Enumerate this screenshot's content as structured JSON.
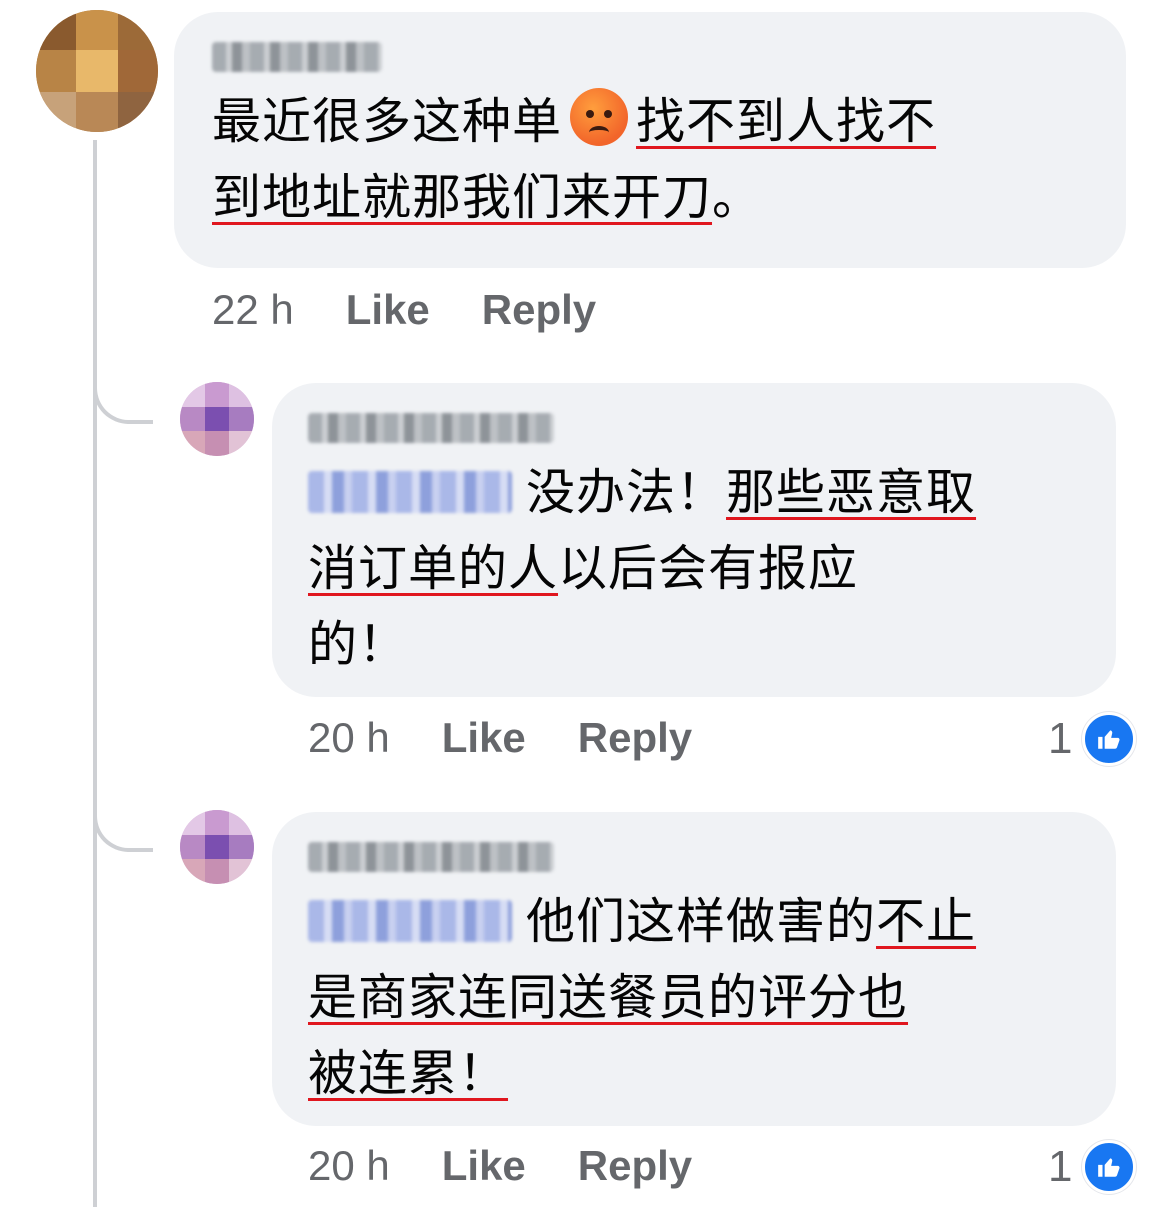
{
  "colors": {
    "bubble_bg": "#f0f2f5",
    "meta_text": "#65676b",
    "underline": "#e0161e",
    "like_blue": "#1877f2"
  },
  "comments": [
    {
      "author": "Lee Liu",
      "text_parts": [
        "最近很多这种单",
        "找不到人找不",
        "到地址就那我们来开刀",
        "。"
      ],
      "emoji": "angry-face",
      "time": "22 h",
      "like_label": "Like",
      "reply_label": "Reply"
    },
    {
      "author": "Wendy Lim",
      "mention": "Lee Liu",
      "text_parts": [
        "没办法！",
        "那些恶意取",
        "消订单的人",
        "以后会有报应",
        "的！"
      ],
      "time": "20 h",
      "like_label": "Like",
      "reply_label": "Reply",
      "reaction_count": "1",
      "reaction_icon": "thumbs-up-icon"
    },
    {
      "author": "Wendy Lim",
      "mention": "Lee Liu",
      "text_parts": [
        "他们这样做害的",
        "不止",
        "是商家连同送餐员的评分也",
        "被连累！"
      ],
      "time": "20 h",
      "like_label": "Like",
      "reply_label": "Reply",
      "reaction_count": "1",
      "reaction_icon": "thumbs-up-icon"
    }
  ]
}
